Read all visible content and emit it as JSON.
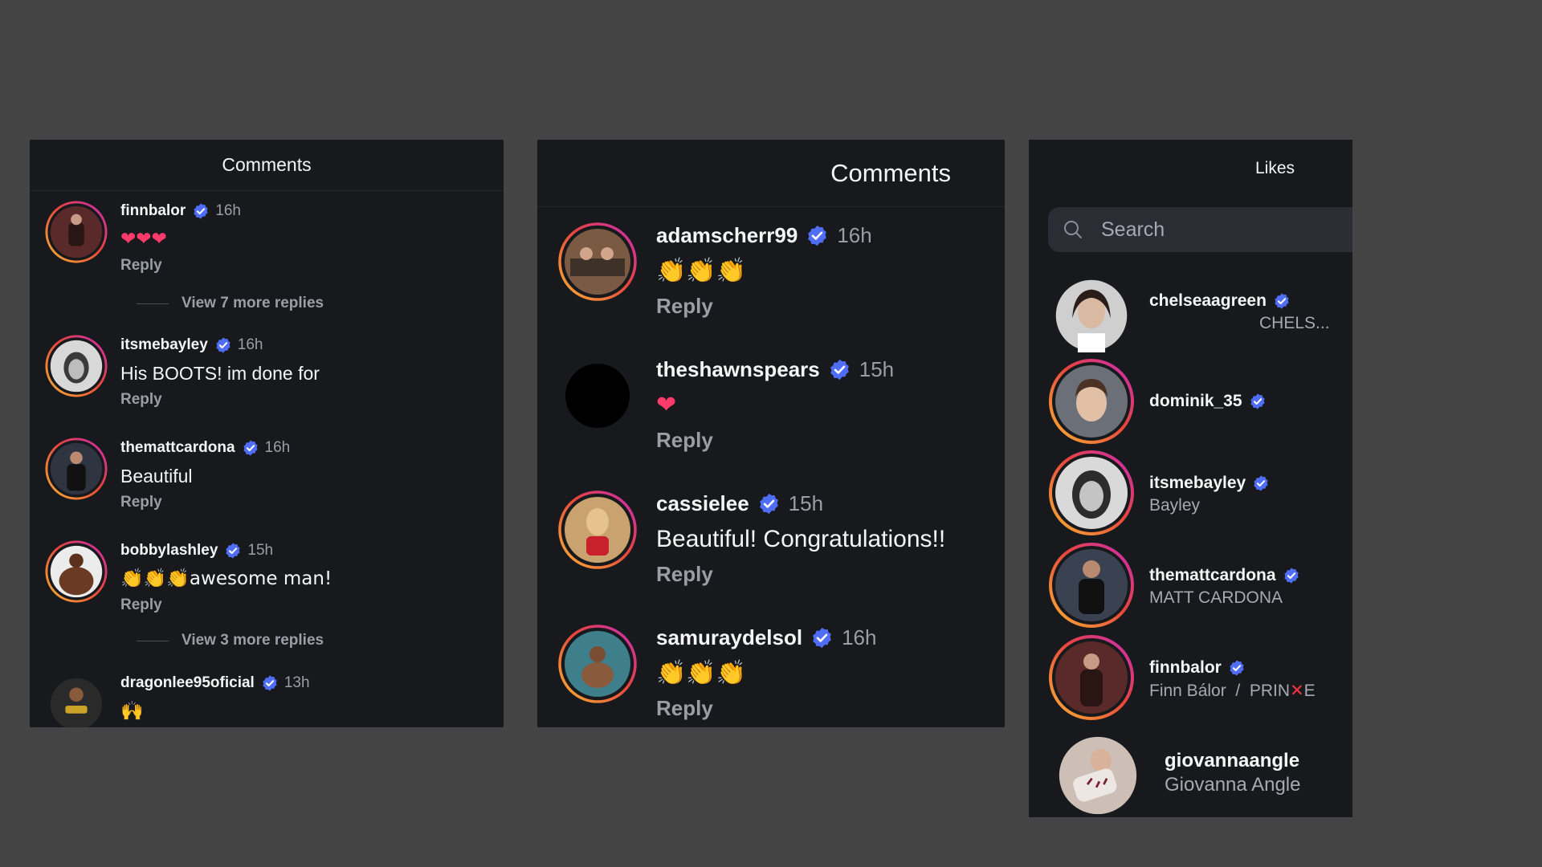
{
  "colors": {
    "background": "#444444",
    "panel": "#17191d",
    "verified": "#4f6df5",
    "muted_text": "#9a9ea6",
    "story_ring_start": "#f9b233",
    "story_ring_end": "#d62a9d"
  },
  "panel1": {
    "title": "Comments",
    "comments": [
      {
        "username": "finnbalor",
        "time": "16h",
        "text": "❤❤❤",
        "reply": "Reply"
      },
      {
        "username": "itsmebayley",
        "time": "16h",
        "text": "His BOOTS! im done for",
        "reply": "Reply"
      },
      {
        "username": "themattcardona",
        "time": "16h",
        "text": "Beautiful",
        "reply": "Reply"
      },
      {
        "username": "bobbylashley",
        "time": "15h",
        "text": "👏👏👏awesome man!",
        "reply": "Reply"
      },
      {
        "username": "dragonlee95oficial",
        "time": "13h",
        "text": "🙌"
      }
    ],
    "more_replies": [
      "View 7 more replies",
      "View 3 more replies"
    ]
  },
  "panel2": {
    "title": "Comments",
    "comments": [
      {
        "username": "adamscherr99",
        "time": "16h",
        "text": "👏👏👏",
        "reply": "Reply"
      },
      {
        "username": "theshawnspears",
        "time": "15h",
        "text": "❤",
        "reply": "Reply"
      },
      {
        "username": "cassielee",
        "time": "15h",
        "text": "Beautiful! Congratulations!!",
        "reply": "Reply"
      },
      {
        "username": "samuraydelsol",
        "time": "16h",
        "text": "👏👏👏",
        "reply": "Reply"
      }
    ]
  },
  "panel3": {
    "title": "Likes",
    "search_placeholder": "Search",
    "likes": [
      {
        "username": "chelseaagreen",
        "subtitle": "CHELS..."
      },
      {
        "username": "dominik_35",
        "subtitle": ""
      },
      {
        "username": "itsmebayley",
        "subtitle": "Bayley"
      },
      {
        "username": "themattcardona",
        "subtitle": "MATT CARDONA"
      },
      {
        "username": "finnbalor",
        "subtitle_prefix": "Finn Bálor  /  PRIN",
        "subtitle_mark": "✕",
        "subtitle_suffix": "E"
      },
      {
        "username": "giovannaangle",
        "subtitle": "Giovanna Angle"
      }
    ]
  }
}
